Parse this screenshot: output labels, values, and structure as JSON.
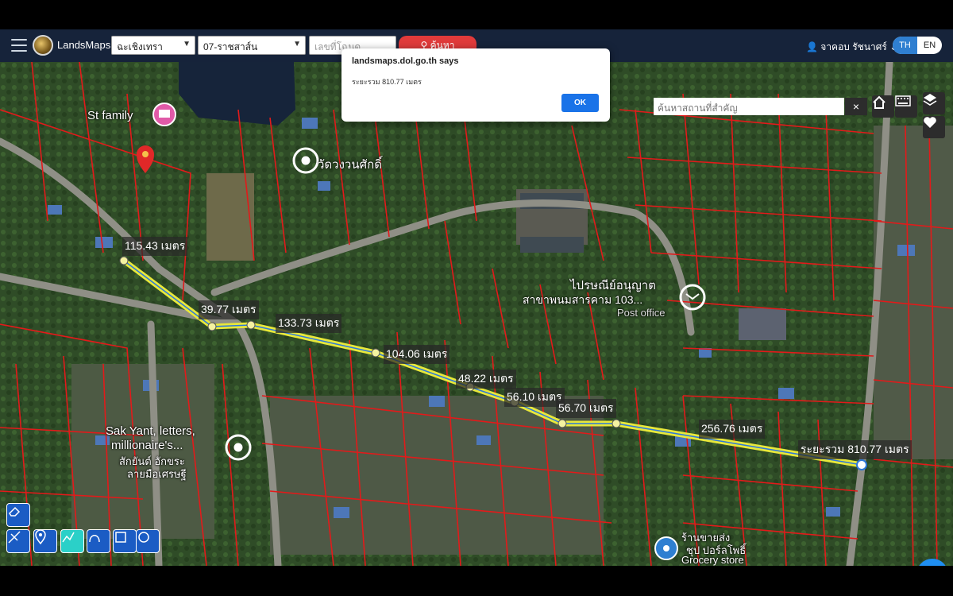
{
  "toolbar": {
    "brand": "LandsMaps",
    "province": "ฉะเชิงเทรา",
    "district": "07-ราชสาส์น",
    "parcel_placeholder": "เลขที่โฉนด",
    "search_label": "ค้นหา",
    "user_name": "จาคอบ รัชนาศร์",
    "lang_th": "TH",
    "lang_en": "EN"
  },
  "map_controls": {
    "place_search_placeholder": "ค้นหาสถานที่สำคัญ",
    "clear_label": "×"
  },
  "dialog": {
    "title": "landsmaps.dol.go.th says",
    "message": "ระยะรวม 810.77 เมตร",
    "ok_label": "OK"
  },
  "measurements": [
    "115.43 เมตร",
    "39.77 เมตร",
    "133.73 เมตร",
    "104.06 เมตร",
    "48.22 เมตร",
    "56.10 เมตร",
    "56.70 เมตร",
    "256.76 เมตร",
    "ระยะรวม 810.77 เมตร"
  ],
  "places": {
    "family": "St family",
    "temple": "วัดวงวนศักดิ์",
    "post_office_th": "ไปรษณีย์อนุญาต",
    "post_office_branch": "สาขาพนมสารคาม 103...",
    "post_office_en": "Post office",
    "sakyant_line1": "Sak Yant, letters,",
    "sakyant_line2": "millionaire's...",
    "sakyant_line3": "สักยันต์ อักขระ",
    "sakyant_line4": "ลายมือเศรษฐี",
    "grocery_th": "ร้านขายส่ง",
    "grocery_th2": "ชุป ปอร์ลโพธิ์",
    "grocery_en": "Grocery store"
  },
  "chat_label": "•••"
}
